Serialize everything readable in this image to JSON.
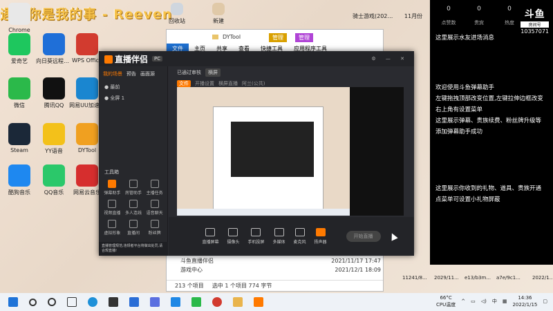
{
  "overlay_title": "遇见你是我的事 - Reeven",
  "desktop": {
    "icons": [
      {
        "label": "Chrome",
        "color": "#e8e8e8"
      },
      {
        "label": "爱奇艺",
        "color": "#1ec75e"
      },
      {
        "label": "向日葵远程控制",
        "color": "#1f6fd8"
      },
      {
        "label": "WPS Office",
        "color": "#d23b2f"
      },
      {
        "label": "微信",
        "color": "#2bb94a"
      },
      {
        "label": "腾讯QQ",
        "color": "#111111"
      },
      {
        "label": "网易UU加速器",
        "color": "#1a86d0"
      },
      {
        "label": "Steam",
        "color": "#1b2838"
      },
      {
        "label": "YY语音",
        "color": "#f3c11a"
      },
      {
        "label": "DYTool",
        "color": "#f0a020"
      },
      {
        "label": "酷狗音乐",
        "color": "#1e88f0"
      },
      {
        "label": "QQ音乐",
        "color": "#2bc86a"
      },
      {
        "label": "网易云音乐",
        "color": "#d62e2e"
      }
    ],
    "top_row": [
      "回收站",
      "新建"
    ],
    "top_right_items": [
      "骑士游戏(2022新)",
      "11月份"
    ]
  },
  "explorer": {
    "title": "DYTool",
    "manage_tab_1": "管理",
    "manage_tab_2": "管理",
    "ribbon": [
      "文件",
      "主页",
      "共享",
      "查看",
      "快捷工具",
      "应用程序工具"
    ],
    "rows": [
      {
        "name": "斗鱼直播伴侣",
        "date": "2021/11/17 17:47"
      },
      {
        "name": "游戏中心",
        "date": "2021/12/1 18:09"
      }
    ],
    "status_count": "213 个项目",
    "status_selected": "选中 1 个项目  774 字节"
  },
  "stream_app": {
    "logo": "直播伴侣",
    "logo_sub": "PC",
    "tabs": [
      "我的场景",
      "预告",
      "画面源"
    ],
    "scenes": [
      "最前",
      "全屏 1"
    ],
    "header_status": "已通过审核",
    "header_badge": "横屏",
    "sub_tag": "文件",
    "sub_items": [
      "开播设置",
      "横屏直播",
      "阿兰(公共)"
    ],
    "tools_title": "工具箱",
    "tools": [
      "弹幕助手",
      "房管助手",
      "主播任务",
      "视频直播",
      "多人连线",
      "语音聊天",
      "虚拟形象",
      "直播间",
      "粉丝牌"
    ],
    "controls": [
      "直播屏幕",
      "摄像头",
      "手机投屏",
      "多媒体",
      "麦克风",
      "扬声器"
    ],
    "go_live": "开始直播",
    "notice": "直播管理规范,违规者平台将做出处罚,请合规直播!"
  },
  "danmu_panel": {
    "stats": [
      {
        "num": "0",
        "label": "点赞数"
      },
      {
        "num": "0",
        "label": "贵宾"
      },
      {
        "num": "0",
        "label": "热度"
      }
    ],
    "brand": "斗鱼",
    "room_label": "房间号",
    "room_id": "10357071",
    "water_notice": "这里展示水友进场消息",
    "welcome_lines": [
      "欢迎使用斗鱼弹幕助手",
      "左键拖拽顶部改变位置,左键拉伸边框改变",
      "右上角有设置菜单",
      "这里展示弹幕、贵族续费、粉丝牌升级等",
      "添加弹幕助手成功"
    ],
    "gift_lines": [
      "这里展示你收到的礼物、道具、贵族开通",
      "点菜单可设置小礼物屏蔽"
    ]
  },
  "bottom_files": [
    "11241/8...",
    "2029/11...",
    "e13/b3m...",
    "a7e/9c1...",
    "2022/1..."
  ],
  "taskbar": {
    "weather_temp": "66°C",
    "weather_label": "CPU温度",
    "ime": "中",
    "time": "14:36",
    "date": "2022/1/15"
  }
}
